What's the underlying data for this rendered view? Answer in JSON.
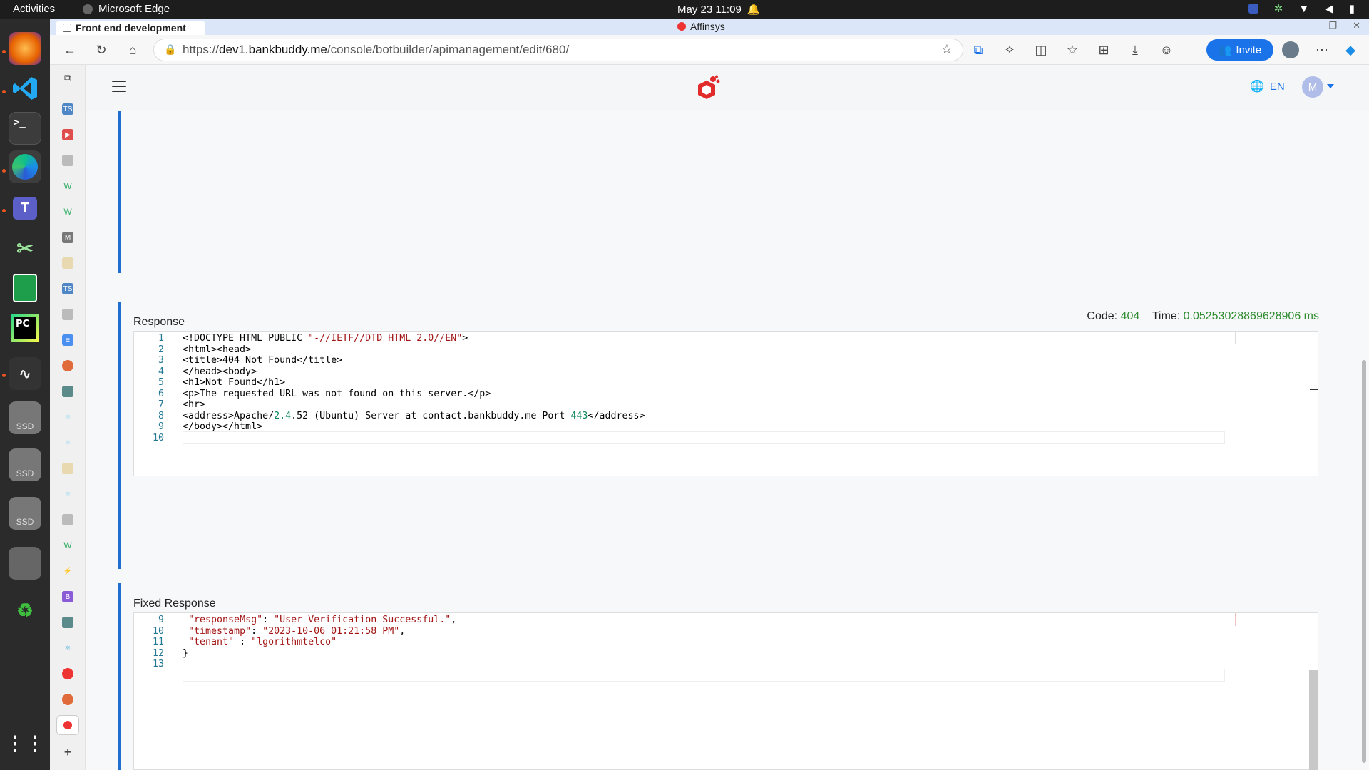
{
  "system": {
    "activities": "Activities",
    "app_name": "Microsoft Edge",
    "clock": "May 23  11:09"
  },
  "browser": {
    "tab_title": "Front end development",
    "window_title": "Affinsys",
    "url_prefix": "https://",
    "url_host": "dev1.bankbuddy.me",
    "url_path": "/console/botbuilder/apimanagement/edit/680/",
    "invite_label": "Invite"
  },
  "app": {
    "language": "EN",
    "avatar_initial": "M"
  },
  "response": {
    "title": "Response",
    "code_label": "Code:",
    "code_value": "404",
    "time_label": "Time:",
    "time_value": "0.05253028869628906 ms",
    "lines": [
      {
        "n": "1",
        "parts": [
          [
            "<!DOCTYPE HTML PUBLIC ",
            ""
          ],
          [
            "\"-//IETF//DTD HTML 2.0//EN\"",
            "str"
          ],
          [
            ">",
            ""
          ]
        ]
      },
      {
        "n": "2",
        "parts": [
          [
            "<html><head>",
            ""
          ]
        ]
      },
      {
        "n": "3",
        "parts": [
          [
            "<title>404 Not Found</title>",
            ""
          ]
        ]
      },
      {
        "n": "4",
        "parts": [
          [
            "</head><body>",
            ""
          ]
        ]
      },
      {
        "n": "5",
        "parts": [
          [
            "<h1>Not Found</h1>",
            ""
          ]
        ]
      },
      {
        "n": "6",
        "parts": [
          [
            "<p>The requested URL was not found on this server.</p>",
            ""
          ]
        ]
      },
      {
        "n": "7",
        "parts": [
          [
            "<hr>",
            ""
          ]
        ]
      },
      {
        "n": "8",
        "parts": [
          [
            "<address>Apache/",
            ""
          ],
          [
            "2.4",
            "num"
          ],
          [
            ".52 (Ubuntu) Server at contact.bankbuddy.me Port ",
            ""
          ],
          [
            "443",
            "num"
          ],
          [
            "</address>",
            ""
          ]
        ]
      },
      {
        "n": "9",
        "parts": [
          [
            "</body></html>",
            ""
          ]
        ]
      },
      {
        "n": "10",
        "parts": []
      }
    ]
  },
  "fixed_response": {
    "title": "Fixed Response",
    "lines": [
      {
        "n": "9",
        "parts": [
          [
            " ",
            ""
          ],
          [
            "\"responseMsg\"",
            "key"
          ],
          [
            ": ",
            ""
          ],
          [
            "\"User Verification Successful.\"",
            "str"
          ],
          [
            ",",
            ""
          ]
        ]
      },
      {
        "n": "10",
        "parts": [
          [
            " ",
            ""
          ],
          [
            "\"timestamp\"",
            "key"
          ],
          [
            ": ",
            ""
          ],
          [
            "\"2023-10-06 01:21:58 PM\"",
            "str"
          ],
          [
            ",",
            ""
          ]
        ]
      },
      {
        "n": "11",
        "parts": [
          [
            " ",
            ""
          ],
          [
            "\"tenant\"",
            "key"
          ],
          [
            " : ",
            ""
          ],
          [
            "\"lgorithmtelco\"",
            "str"
          ]
        ]
      },
      {
        "n": "12",
        "parts": [
          [
            "}",
            ""
          ]
        ]
      },
      {
        "n": "13",
        "parts": []
      }
    ]
  },
  "icons": {
    "dock": [
      "firefox-icon",
      "vscode-icon",
      "terminal-icon",
      "edge-icon",
      "teams-icon",
      "scissors-icon",
      "sheets-icon",
      "pycharm-icon",
      "monitor-icon",
      "ssd-icon",
      "ssd-icon",
      "ssd-icon",
      "sd-card-icon",
      "recycle-icon",
      "app-grid-icon"
    ]
  },
  "dock_labels": {
    "ssd": "SSD",
    "pycharm": "PC"
  }
}
